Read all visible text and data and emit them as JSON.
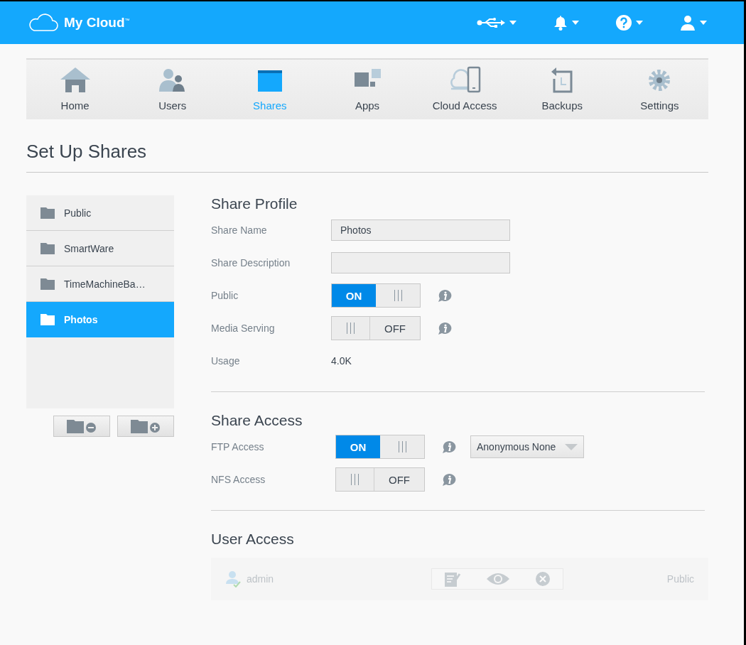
{
  "header": {
    "logo": "My Cloud$^{™}$"
  },
  "nav_tabs": [
    {
      "label": "Home",
      "selected": false
    },
    {
      "label": "Users",
      "selected": false
    },
    {
      "label": "Shares",
      "selected": true
    },
    {
      "label": "Apps",
      "selected": false
    },
    {
      "label": "Cloud Access",
      "selected": false
    },
    {
      "label": "Backups",
      "selected": false
    },
    {
      "label": "Settings",
      "selected": false
    }
  ],
  "page_title": "Set Up Shares",
  "shares": [
    {
      "name": "Public",
      "selected": false
    },
    {
      "name": "SmartWare",
      "selected": false
    },
    {
      "name": "TimeMachineBa…",
      "selected": false
    },
    {
      "name": "Photos",
      "selected": true
    }
  ],
  "share_profile": {
    "title": "Share Profile",
    "rows": [
      {
        "kind": "field",
        "label": "Share Name",
        "value": "Photos"
      },
      {
        "kind": "field",
        "label": "Share Description"
      },
      {
        "kind": "toggle",
        "label": "Public",
        "on": true,
        "state_label": "ON"
      },
      {
        "kind": "toggle",
        "label": "Media Serving",
        "on": false,
        "state_label": "OFF"
      },
      {
        "kind": "value",
        "label": "Usage",
        "value": "4.0K"
      }
    ]
  },
  "share_access": {
    "title": "Share Access",
    "rows": [
      {
        "kind": "toggle",
        "label": "FTP Access",
        "on": true,
        "state_label": "ON",
        "dropdown": "Anonymous None"
      },
      {
        "kind": "toggle",
        "label": "NFS Access",
        "on": false,
        "state_label": "OFF"
      }
    ]
  },
  "user_access": {
    "title": "User Access",
    "users": [
      {
        "name": "admin",
        "access": "Public",
        "disabled": true
      }
    ]
  }
}
